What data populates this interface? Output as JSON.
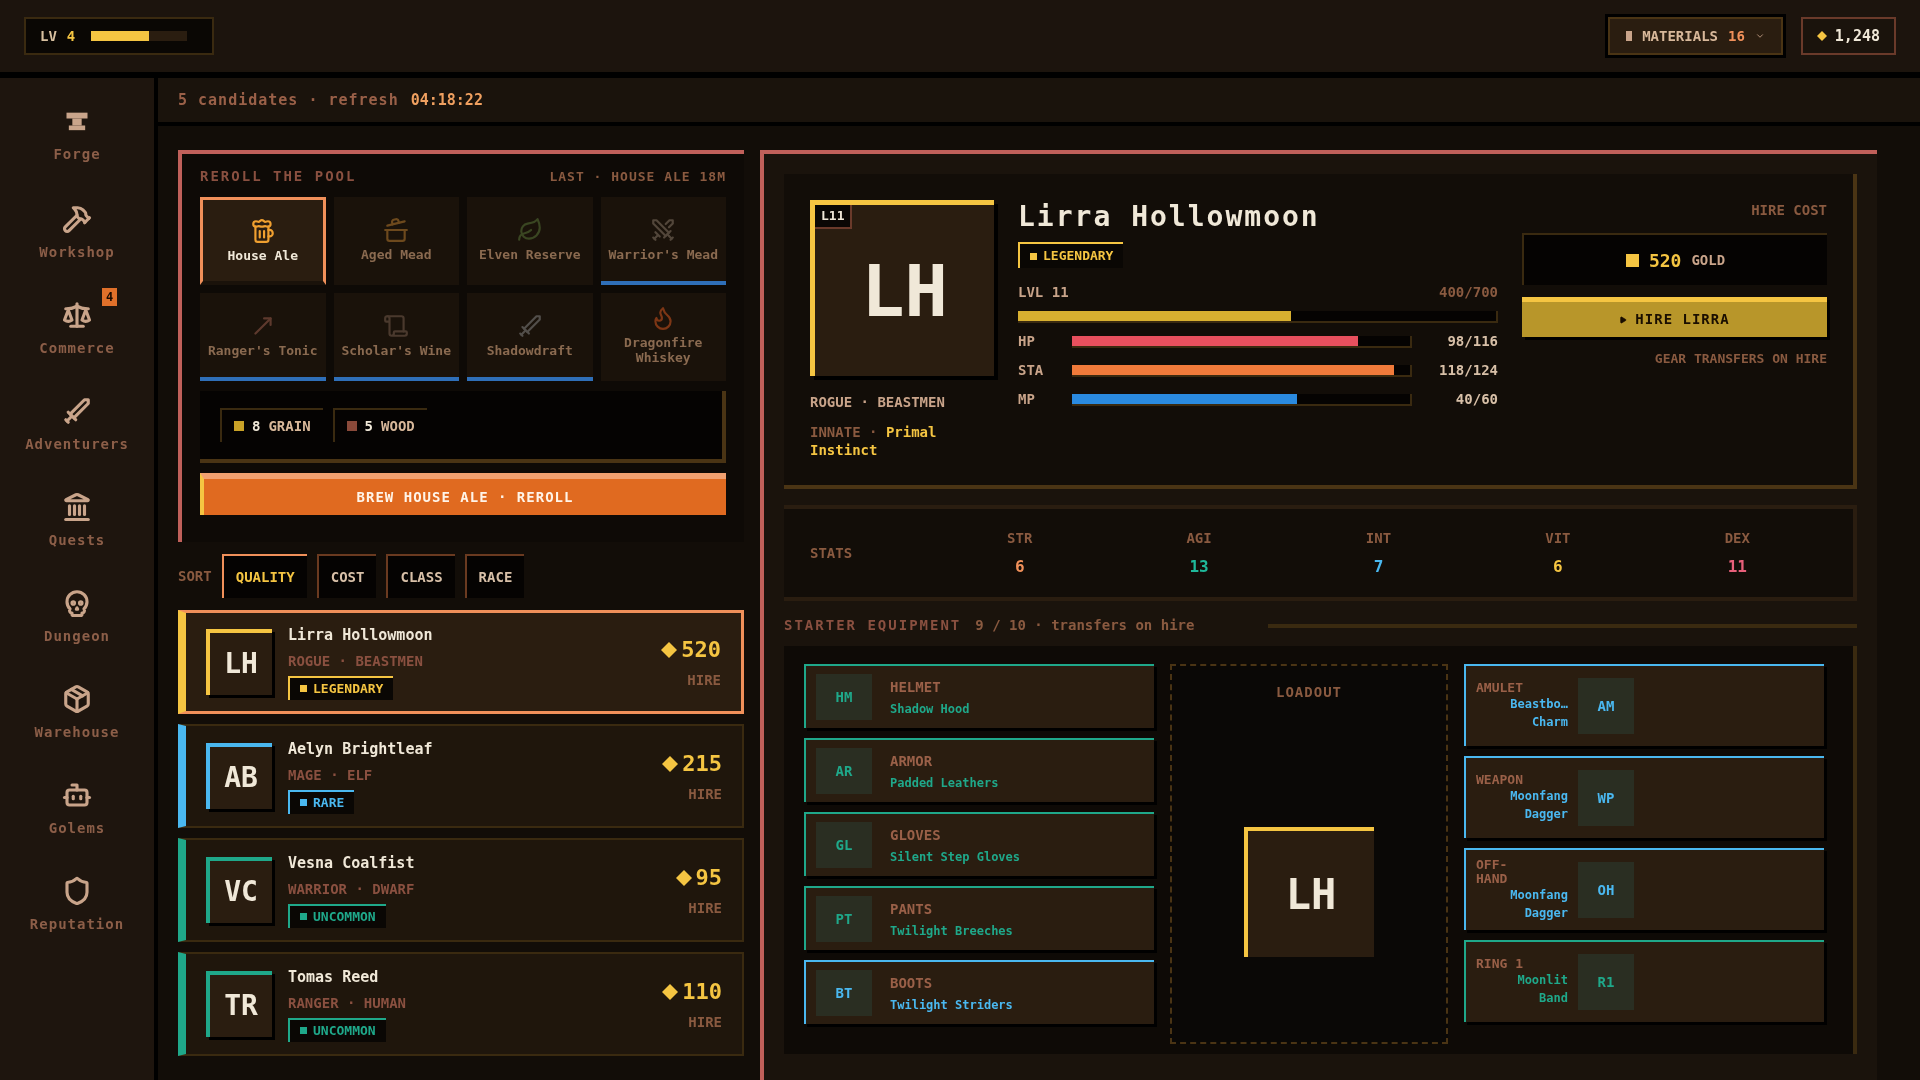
{
  "top_bar": {
    "level_label": "LV",
    "level": "4",
    "xp": {
      "level": 0.6
    },
    "materials": {
      "label": "MATERIALS",
      "count": "16"
    },
    "gold": "1,248"
  },
  "sidebar": {
    "items": [
      {
        "label": "Forge"
      },
      {
        "label": "Workshop"
      },
      {
        "label": "Commerce",
        "badge": "4"
      },
      {
        "label": "Adventurers"
      },
      {
        "label": "Quests"
      },
      {
        "label": "Dungeon"
      },
      {
        "label": "Warehouse"
      },
      {
        "label": "Golems"
      },
      {
        "label": "Reputation"
      }
    ]
  },
  "header": {
    "summary": "5 candidates · refresh",
    "timer": "04:18:22"
  },
  "reroll": {
    "title": "REROLL THE POOL",
    "last": "LAST · HOUSE ALE 18M",
    "brews": [
      {
        "name": "House Ale",
        "selected": true,
        "kind": "common"
      },
      {
        "name": "Aged Mead",
        "selected": false,
        "kind": "common"
      },
      {
        "name": "Elven Reserve",
        "selected": false,
        "kind": "common"
      },
      {
        "name": "Warrior's Mead",
        "selected": false,
        "kind": "rare"
      },
      {
        "name": "Ranger's Tonic",
        "selected": false,
        "kind": "rare"
      },
      {
        "name": "Scholar's Wine",
        "selected": false,
        "kind": "rare"
      },
      {
        "name": "Shadowdraft",
        "selected": false,
        "kind": "rare"
      },
      {
        "name": "Dragonfire Whiskey",
        "selected": false,
        "kind": "common"
      }
    ],
    "ingredients": [
      {
        "amount": "8",
        "name": "GRAIN",
        "color": "#c9a227"
      },
      {
        "amount": "5",
        "name": "WOOD",
        "color": "#8a4a3a"
      }
    ],
    "button": "BREW HOUSE ALE · REROLL"
  },
  "sort": {
    "label": "SORT",
    "options": [
      {
        "label": "QUALITY",
        "selected": true
      },
      {
        "label": "COST",
        "selected": false
      },
      {
        "label": "CLASS",
        "selected": false
      },
      {
        "label": "RACE",
        "selected": false
      }
    ]
  },
  "candidates": [
    {
      "initials": "LH",
      "name": "Lirra Hollowmoon",
      "class_race": "ROGUE · BEASTMEN",
      "rarity": "LEGENDARY",
      "color": "#f5c542",
      "cost": "520",
      "action": "HIRE",
      "selected": true
    },
    {
      "initials": "AB",
      "name": "Aelyn Brightleaf",
      "class_race": "MAGE · ELF",
      "rarity": "RARE",
      "color": "#4ab8f0",
      "cost": "215",
      "action": "HIRE",
      "selected": false
    },
    {
      "initials": "VC",
      "name": "Vesna Coalfist",
      "class_race": "WARRIOR · DWARF",
      "rarity": "UNCOMMON",
      "color": "#1fa88a",
      "cost": "95",
      "action": "HIRE",
      "selected": false
    },
    {
      "initials": "TR",
      "name": "Tomas Reed",
      "class_race": "RANGER · HUMAN",
      "rarity": "UNCOMMON",
      "color": "#1fa88a",
      "cost": "110",
      "action": "HIRE",
      "selected": false
    }
  ],
  "detail": {
    "initials": "LH",
    "level_badge": "L11",
    "name": "Lirra Hollowmoon",
    "rarity": "LEGENDARY",
    "color": "#f5c542",
    "class_race": "ROGUE · BEASTMEN",
    "innate_label": "INNATE ·",
    "innate": "Primal Instinct",
    "xp": {
      "label": "LVL 11",
      "reading": "400/700",
      "level": 0.571
    },
    "bars": [
      {
        "label": "HP",
        "reading": "98/116",
        "level": 0.845,
        "color": "#e8505e"
      },
      {
        "label": "STA",
        "reading": "118/124",
        "level": 0.952,
        "color": "#f07a3a"
      },
      {
        "label": "MP",
        "reading": "40/60",
        "level": 0.667,
        "color": "#2a8ae0"
      }
    ],
    "hire_cost_label": "HIRE COST",
    "cost": "520",
    "cost_unit": "GOLD",
    "hire_button": "HIRE LIRRA",
    "note": "GEAR TRANSFERS ON HIRE",
    "stats_label": "STATS",
    "stats": [
      {
        "label": "STR",
        "value": "6",
        "color": "#f0905a"
      },
      {
        "label": "AGI",
        "value": "13",
        "color": "#1fb89a"
      },
      {
        "label": "INT",
        "value": "7",
        "color": "#4ab8f0"
      },
      {
        "label": "VIT",
        "value": "6",
        "color": "#f5c542"
      },
      {
        "label": "DEX",
        "value": "11",
        "color": "#e8607a"
      }
    ]
  },
  "equipment": {
    "title": "STARTER EQUIPMENT",
    "count": "9 / 10 · transfers on hire",
    "loadout_label": "LOADOUT",
    "loadout_initials": "LH",
    "left_slots": [
      {
        "code": "HM",
        "slot": "HELMET",
        "item": "Shadow Hood",
        "color": "#1fa88a"
      },
      {
        "code": "AR",
        "slot": "ARMOR",
        "item": "Padded Leathers",
        "color": "#1fa88a"
      },
      {
        "code": "GL",
        "slot": "GLOVES",
        "item": "Silent Step Gloves",
        "color": "#1fa88a"
      },
      {
        "code": "PT",
        "slot": "PANTS",
        "item": "Twilight Breeches",
        "color": "#1fa88a"
      },
      {
        "code": "BT",
        "slot": "BOOTS",
        "item": "Twilight Striders",
        "color": "#4ab8f0"
      }
    ],
    "right_slots": [
      {
        "code": "AM",
        "slot": "AMULET",
        "item": "Beastbo… Charm",
        "color": "#4ab8f0"
      },
      {
        "code": "WP",
        "slot": "WEAPON",
        "item": "Moonfang Dagger",
        "color": "#4ab8f0"
      },
      {
        "code": "OH",
        "slot": "OFF-HAND",
        "item": "Moonfang Dagger",
        "color": "#4ab8f0"
      },
      {
        "code": "R1",
        "slot": "RING 1",
        "item": "Moonlit Band",
        "color": "#1fa88a"
      }
    ]
  }
}
